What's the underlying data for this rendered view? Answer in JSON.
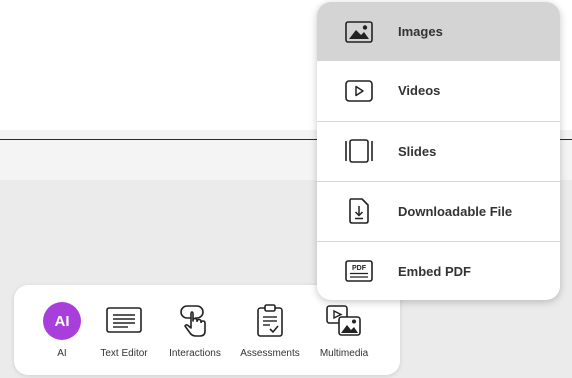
{
  "menu": {
    "items": [
      {
        "label": "Images",
        "icon": "image-icon"
      },
      {
        "label": "Videos",
        "icon": "video-play-icon"
      },
      {
        "label": "Slides",
        "icon": "slides-icon"
      },
      {
        "label": "Downloadable File",
        "icon": "download-file-icon"
      },
      {
        "label": "Embed PDF",
        "icon": "pdf-icon"
      }
    ]
  },
  "toolbar": {
    "ai_badge": "AI",
    "items": [
      {
        "label": "AI",
        "icon": "ai-icon"
      },
      {
        "label": "Text Editor",
        "icon": "text-editor-icon"
      },
      {
        "label": "Interactions",
        "icon": "interactions-icon"
      },
      {
        "label": "Assessments",
        "icon": "assessments-icon"
      },
      {
        "label": "Multimedia",
        "icon": "multimedia-icon"
      }
    ]
  },
  "colors": {
    "ai_accent": "#a93fdb",
    "menu_selected_bg": "#d4d4d4"
  }
}
